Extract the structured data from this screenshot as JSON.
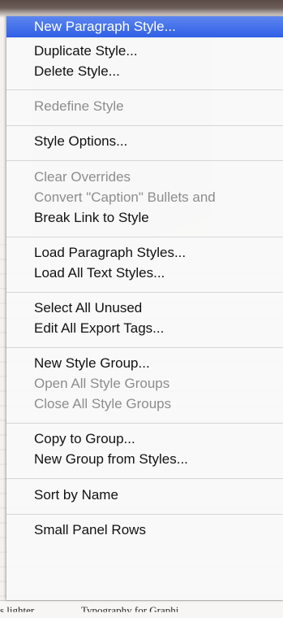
{
  "background": {
    "footer_left": "s lighter.",
    "footer_right": "Typography for Graphi"
  },
  "menu": {
    "highlight_color": "#3b6ae8",
    "items": [
      {
        "label": "New Paragraph Style...",
        "enabled": true,
        "highlighted": true
      },
      {
        "label": "Duplicate Style...",
        "enabled": true
      },
      {
        "label": "Delete Style...",
        "enabled": true
      },
      {
        "label": "Redefine Style",
        "enabled": false
      },
      {
        "label": "Style Options...",
        "enabled": true
      },
      {
        "label": "Clear Overrides",
        "enabled": false
      },
      {
        "label": "Convert \"Caption\" Bullets and",
        "enabled": false
      },
      {
        "label": "Break Link to Style",
        "enabled": true
      },
      {
        "label": "Load Paragraph Styles...",
        "enabled": true
      },
      {
        "label": "Load All Text Styles...",
        "enabled": true
      },
      {
        "label": "Select All Unused",
        "enabled": true
      },
      {
        "label": "Edit All Export Tags...",
        "enabled": true
      },
      {
        "label": "New Style Group...",
        "enabled": true
      },
      {
        "label": "Open All Style Groups",
        "enabled": false
      },
      {
        "label": "Close All Style Groups",
        "enabled": false
      },
      {
        "label": "Copy to Group...",
        "enabled": true
      },
      {
        "label": "New Group from Styles...",
        "enabled": true
      },
      {
        "label": "Sort by Name",
        "enabled": true
      },
      {
        "label": "Small Panel Rows",
        "enabled": true
      }
    ]
  }
}
